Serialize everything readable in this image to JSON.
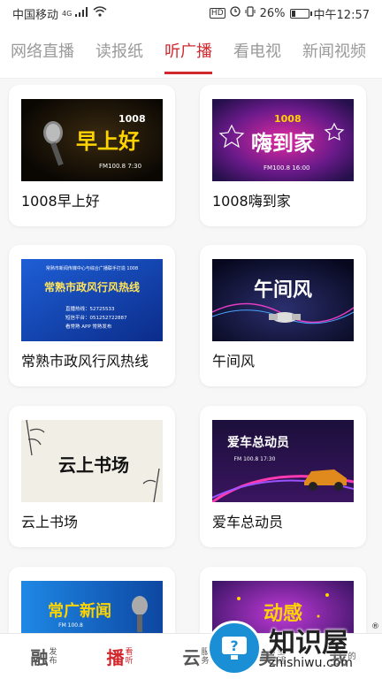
{
  "status": {
    "carrier": "中国移动",
    "network": "4G",
    "battery": "26%",
    "battery_level": 0.26,
    "time": "中午12:57",
    "hd_badge": "HD"
  },
  "tabs": [
    {
      "label": "网络直播",
      "active": false
    },
    {
      "label": "读报纸",
      "active": false
    },
    {
      "label": "听广播",
      "active": true
    },
    {
      "label": "看电视",
      "active": false
    },
    {
      "label": "新闻视频",
      "active": false
    }
  ],
  "cards": [
    {
      "title": "1008早上好",
      "thumb": {
        "big": "早上好",
        "badge": "1008",
        "sub": "FM100.8  7:30",
        "icon": "microphone-icon"
      }
    },
    {
      "title": "1008嗨到家",
      "thumb": {
        "big": "嗨到家",
        "badge": "1008",
        "sub": "FM100.8  16:00",
        "icon": "stars-icon"
      }
    },
    {
      "title": "常熟市政风行风热线",
      "thumb": {
        "header": "常熟市新闻传媒中心与综合广播联手打造 1008",
        "big": "常熟市政风行风热线",
        "lines": [
          "直播热线：52725533",
          "短信平台：051252722887",
          "看常熟 APP  常熟发布"
        ]
      }
    },
    {
      "title": "午间风",
      "thumb": {
        "big": "午间风",
        "icon": "handshake-icon"
      }
    },
    {
      "title": "云上书场",
      "thumb": {
        "big": "云上书场",
        "icon": "bamboo-icon"
      }
    },
    {
      "title": "爱车总动员",
      "thumb": {
        "big": "爱车总动员",
        "sub": "FM 100.8  17:30",
        "icon": "car-icon"
      }
    },
    {
      "title": "",
      "thumb": {
        "big": "常广新闻",
        "sub": "FM 100.8",
        "icon": "microphone-icon"
      }
    },
    {
      "title": "",
      "thumb": {
        "big": "动感",
        "icon": "stars-icon"
      }
    }
  ],
  "bottom_nav": [
    {
      "big": "融",
      "small": "发布",
      "active": false
    },
    {
      "big": "播",
      "small": "看听",
      "active": true
    },
    {
      "big": "云",
      "small": "服务",
      "active": false
    },
    {
      "big": "美",
      "small": "生活",
      "active": false
    },
    {
      "big": "我",
      "small": "的",
      "active": false
    }
  ],
  "watermark": {
    "title": "知识屋",
    "url": "zhishiwu.com",
    "reg": "®"
  }
}
